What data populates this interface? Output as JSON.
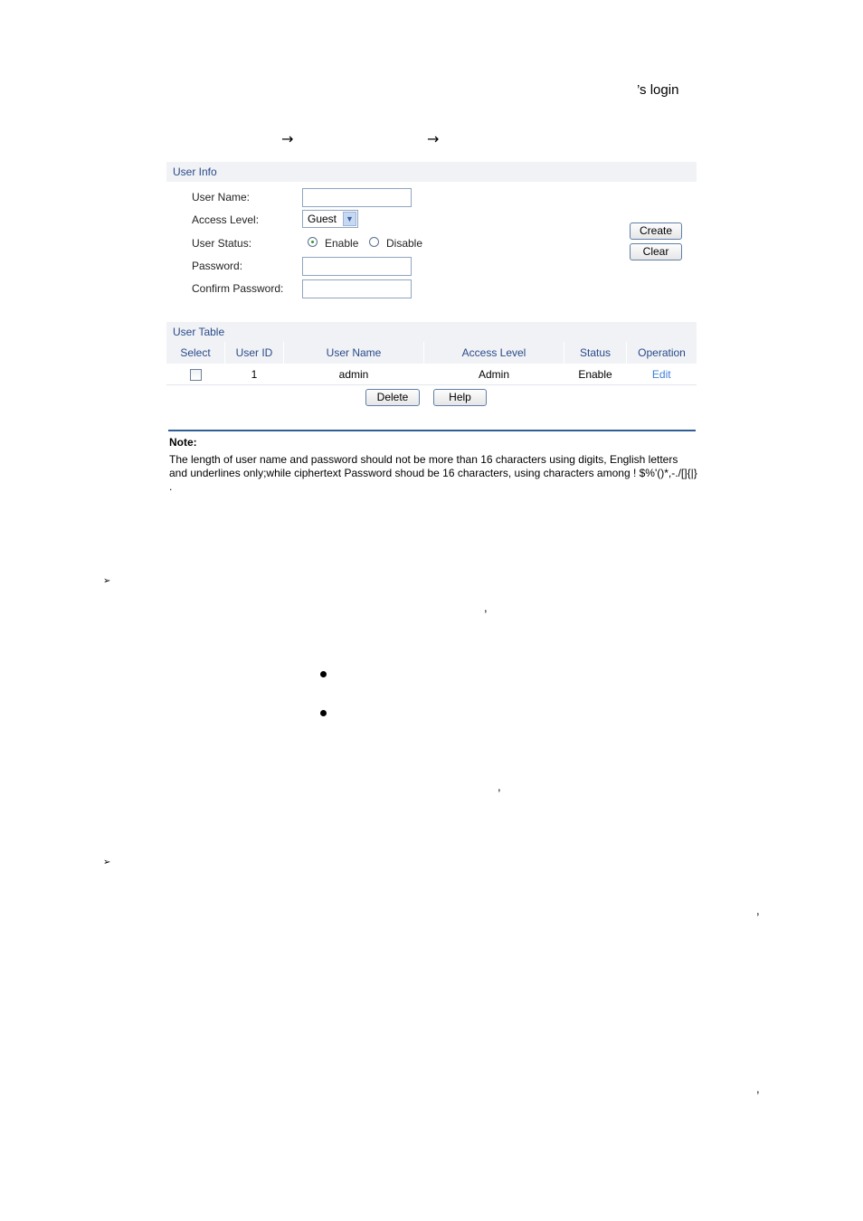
{
  "document": {
    "fragment_login": "’s login",
    "nav_arrow_1": "→",
    "nav_arrow_2": "→",
    "comma": ",",
    "list_marker": "➢",
    "bullet": "●"
  },
  "user_info": {
    "title": "User Info",
    "labels": {
      "user_name": "User Name:",
      "access_level": "Access Level:",
      "user_status": "User Status:",
      "password": "Password:",
      "confirm_password": "Confirm Password:"
    },
    "user_name_value": "",
    "password_value": "",
    "confirm_password_value": "",
    "access_level_selected": "Guest",
    "status_options": [
      {
        "label": "Enable",
        "selected": true
      },
      {
        "label": "Disable",
        "selected": false
      }
    ],
    "create_label": "Create",
    "clear_label": "Clear"
  },
  "user_table": {
    "title": "User Table",
    "columns": [
      "Select",
      "User ID",
      "User Name",
      "Access Level",
      "Status",
      "Operation"
    ],
    "rows": [
      {
        "selected": false,
        "user_id": "1",
        "user_name": "admin",
        "access_level": "Admin",
        "status": "Enable",
        "operation": "Edit"
      }
    ],
    "delete_label": "Delete",
    "help_label": "Help"
  },
  "note": {
    "title": "Note:",
    "text": "The length of user name and password should not be more than 16 characters using digits, English letters and underlines only;while ciphertext Password shoud be 16 characters, using characters among ! $%'()*,-./[]{|} ."
  },
  "colors": {
    "panel_header_bg": "#f0f2f5",
    "panel_header_text": "#2a4a8a",
    "link": "#3f7fd8",
    "note_rule": "#2f5f96"
  }
}
